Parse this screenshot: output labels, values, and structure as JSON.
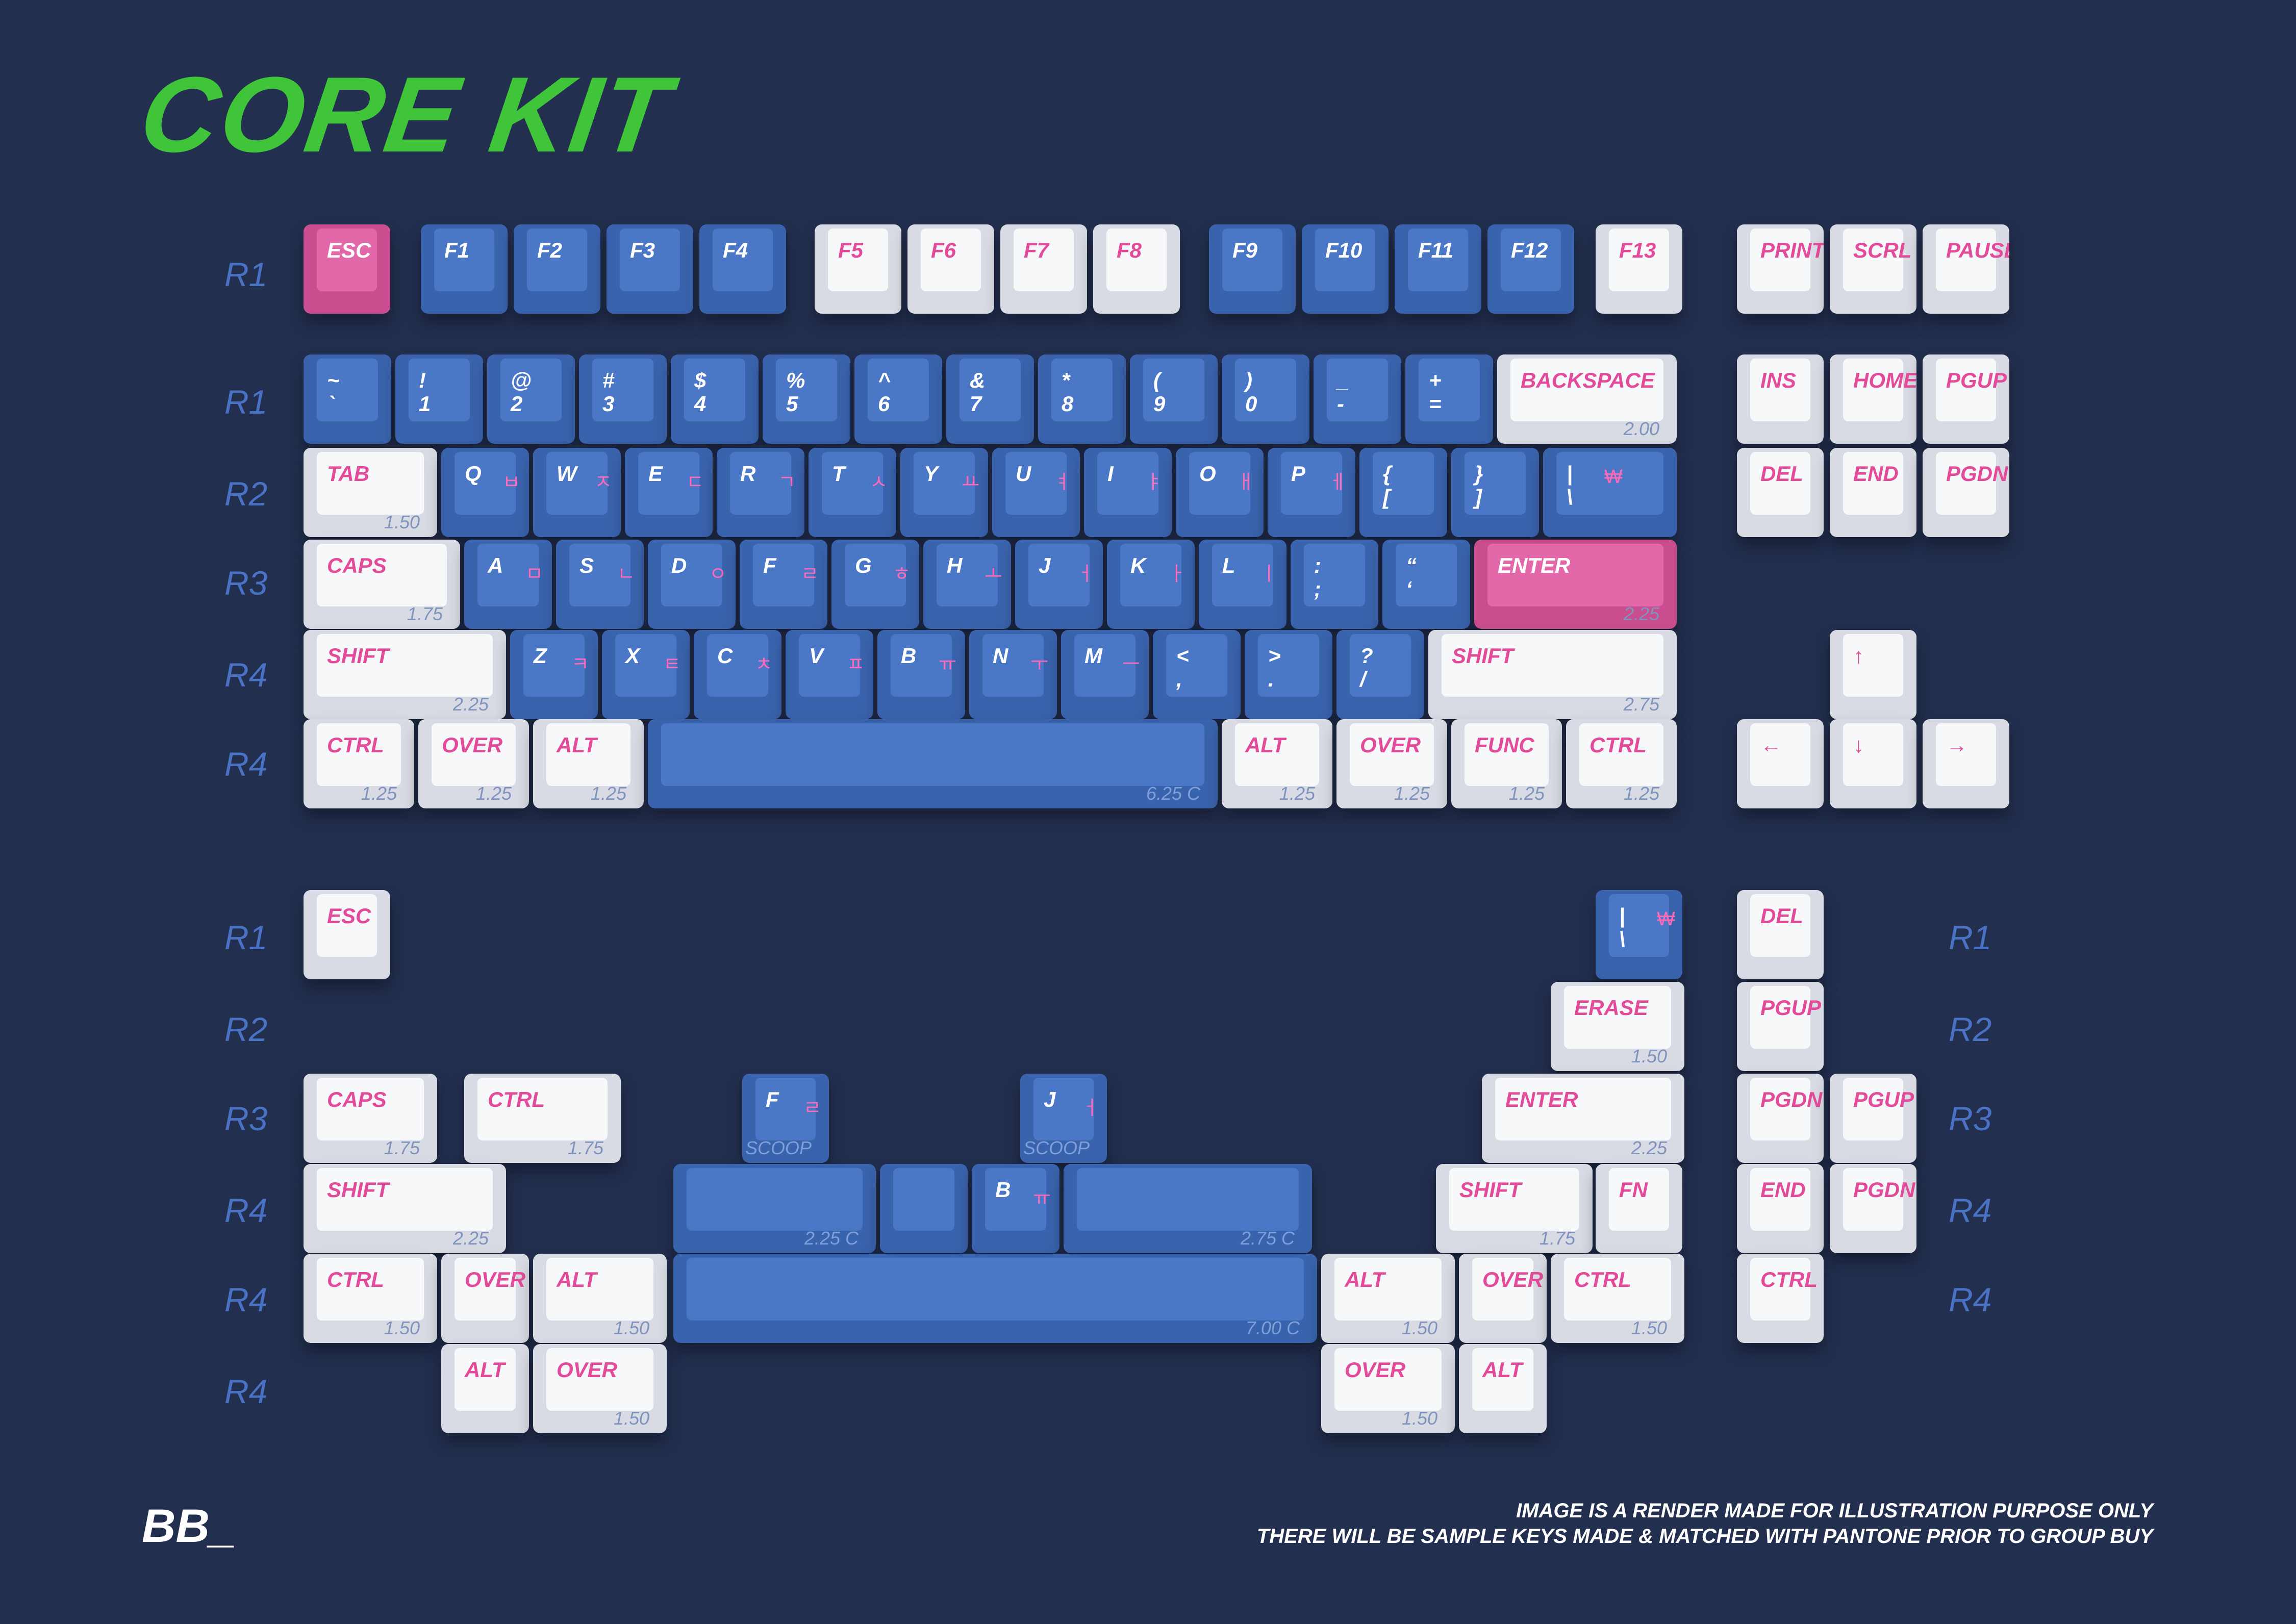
{
  "title": "CORE KIT",
  "row_labels": [
    {
      "id": "r1a",
      "text": "R1"
    },
    {
      "id": "r1b",
      "text": "R1"
    },
    {
      "id": "r2",
      "text": "R2"
    },
    {
      "id": "r3",
      "text": "R3"
    },
    {
      "id": "r4a",
      "text": "R4"
    },
    {
      "id": "r4b",
      "text": "R4"
    },
    {
      "id": "b1",
      "text": "R1"
    },
    {
      "id": "b2",
      "text": "R2"
    },
    {
      "id": "b3",
      "text": "R3"
    },
    {
      "id": "b4",
      "text": "R4"
    },
    {
      "id": "b5",
      "text": "R4"
    },
    {
      "id": "b6",
      "text": "R4"
    },
    {
      "id": "c1",
      "text": "R1"
    },
    {
      "id": "c2",
      "text": "R2"
    },
    {
      "id": "c3",
      "text": "R3"
    },
    {
      "id": "c4",
      "text": "R4"
    },
    {
      "id": "c5",
      "text": "R4"
    }
  ],
  "keys": [
    {
      "id": "esc",
      "legend": "ESC",
      "color": "pink"
    },
    {
      "id": "f1",
      "legend": "F1",
      "color": "blue"
    },
    {
      "id": "f2",
      "legend": "F2",
      "color": "blue"
    },
    {
      "id": "f3",
      "legend": "F3",
      "color": "blue"
    },
    {
      "id": "f4",
      "legend": "F4",
      "color": "blue"
    },
    {
      "id": "f5",
      "legend": "F5",
      "color": "white"
    },
    {
      "id": "f6",
      "legend": "F6",
      "color": "white"
    },
    {
      "id": "f7",
      "legend": "F7",
      "color": "white"
    },
    {
      "id": "f8",
      "legend": "F8",
      "color": "white"
    },
    {
      "id": "f9",
      "legend": "F9",
      "color": "blue"
    },
    {
      "id": "f10",
      "legend": "F10",
      "color": "blue"
    },
    {
      "id": "f11",
      "legend": "F11",
      "color": "blue"
    },
    {
      "id": "f12",
      "legend": "F12",
      "color": "blue"
    },
    {
      "id": "f13",
      "legend": "F13",
      "color": "white"
    },
    {
      "id": "print",
      "legend": "PRINT",
      "color": "white"
    },
    {
      "id": "scrl",
      "legend": "SCRL",
      "color": "white"
    },
    {
      "id": "pause",
      "legend": "PAUSE",
      "color": "white"
    },
    {
      "id": "tilde",
      "legend": "~\n`",
      "color": "blue"
    },
    {
      "id": "k1",
      "legend": "!\n1",
      "color": "blue"
    },
    {
      "id": "k2",
      "legend": "@\n2",
      "color": "blue"
    },
    {
      "id": "k3",
      "legend": "#\n3",
      "color": "blue"
    },
    {
      "id": "k4",
      "legend": "$\n4",
      "color": "blue"
    },
    {
      "id": "k5",
      "legend": "%\n5",
      "color": "blue"
    },
    {
      "id": "k6",
      "legend": "^\n6",
      "color": "blue"
    },
    {
      "id": "k7",
      "legend": "&\n7",
      "color": "blue"
    },
    {
      "id": "k8",
      "legend": "*\n8",
      "color": "blue"
    },
    {
      "id": "k9",
      "legend": "(\n9",
      "color": "blue"
    },
    {
      "id": "k0",
      "legend": ")\n0",
      "color": "blue"
    },
    {
      "id": "minus",
      "legend": "_\n-",
      "color": "blue"
    },
    {
      "id": "equal",
      "legend": "+\n=",
      "color": "blue"
    },
    {
      "id": "backspace",
      "legend": "BACKSPACE",
      "size": "2.00",
      "color": "white"
    },
    {
      "id": "ins",
      "legend": "INS",
      "color": "white"
    },
    {
      "id": "home",
      "legend": "HOME",
      "color": "white"
    },
    {
      "id": "pgup",
      "legend": "PGUP",
      "color": "white"
    },
    {
      "id": "tab",
      "legend": "TAB",
      "size": "1.50",
      "color": "white"
    },
    {
      "id": "q",
      "legend": "Q",
      "sub": "ㅂ",
      "color": "blue"
    },
    {
      "id": "w",
      "legend": "W",
      "sub": "ㅈ",
      "color": "blue"
    },
    {
      "id": "e",
      "legend": "E",
      "sub": "ㄷ",
      "color": "blue"
    },
    {
      "id": "r",
      "legend": "R",
      "sub": "ㄱ",
      "color": "blue"
    },
    {
      "id": "t",
      "legend": "T",
      "sub": "ㅅ",
      "color": "blue"
    },
    {
      "id": "y",
      "legend": "Y",
      "sub": "ㅛ",
      "color": "blue"
    },
    {
      "id": "u",
      "legend": "U",
      "sub": "ㅕ",
      "color": "blue"
    },
    {
      "id": "i",
      "legend": "I",
      "sub": "ㅑ",
      "color": "blue"
    },
    {
      "id": "o",
      "legend": "O",
      "sub": "ㅐ",
      "color": "blue"
    },
    {
      "id": "p",
      "legend": "P",
      "sub": "ㅔ",
      "color": "blue"
    },
    {
      "id": "lbracket",
      "legend": "{\n[",
      "color": "blue"
    },
    {
      "id": "rbracket",
      "legend": "}\n]",
      "color": "blue"
    },
    {
      "id": "backslash",
      "legend": "|\n\\",
      "sub": "₩",
      "color": "blue"
    },
    {
      "id": "del",
      "legend": "DEL",
      "color": "white"
    },
    {
      "id": "end",
      "legend": "END",
      "color": "white"
    },
    {
      "id": "pgdn",
      "legend": "PGDN",
      "color": "white"
    },
    {
      "id": "caps",
      "legend": "CAPS",
      "size": "1.75",
      "color": "white"
    },
    {
      "id": "a",
      "legend": "A",
      "sub": "ㅁ",
      "color": "blue"
    },
    {
      "id": "s",
      "legend": "S",
      "sub": "ㄴ",
      "color": "blue"
    },
    {
      "id": "d",
      "legend": "D",
      "sub": "ㅇ",
      "color": "blue"
    },
    {
      "id": "f",
      "legend": "F",
      "sub": "ㄹ",
      "color": "blue"
    },
    {
      "id": "g",
      "legend": "G",
      "sub": "ㅎ",
      "color": "blue"
    },
    {
      "id": "h",
      "legend": "H",
      "sub": "ㅗ",
      "color": "blue"
    },
    {
      "id": "j",
      "legend": "J",
      "sub": "ㅓ",
      "color": "blue"
    },
    {
      "id": "k",
      "legend": "K",
      "sub": "ㅏ",
      "color": "blue"
    },
    {
      "id": "l",
      "legend": "L",
      "sub": "ㅣ",
      "color": "blue"
    },
    {
      "id": "semicolon",
      "legend": ":\n;",
      "color": "blue"
    },
    {
      "id": "quote",
      "legend": "“\n‘",
      "color": "blue"
    },
    {
      "id": "enter",
      "legend": "ENTER",
      "size": "2.25",
      "color": "pink"
    },
    {
      "id": "lshift",
      "legend": "SHIFT",
      "size": "2.25",
      "color": "white"
    },
    {
      "id": "z",
      "legend": "Z",
      "sub": "ㅋ",
      "color": "blue"
    },
    {
      "id": "x",
      "legend": "X",
      "sub": "ㅌ",
      "color": "blue"
    },
    {
      "id": "c",
      "legend": "C",
      "sub": "ㅊ",
      "color": "blue"
    },
    {
      "id": "v",
      "legend": "V",
      "sub": "ㅍ",
      "color": "blue"
    },
    {
      "id": "b",
      "legend": "B",
      "sub": "ㅠ",
      "color": "blue"
    },
    {
      "id": "n",
      "legend": "N",
      "sub": "ㅜ",
      "color": "blue"
    },
    {
      "id": "m",
      "legend": "M",
      "sub": "ㅡ",
      "color": "blue"
    },
    {
      "id": "comma",
      "legend": "<\n,",
      "color": "blue"
    },
    {
      "id": "period",
      "legend": ">\n.",
      "color": "blue"
    },
    {
      "id": "slash",
      "legend": "?\n/",
      "color": "blue"
    },
    {
      "id": "rshift",
      "legend": "SHIFT",
      "size": "2.75",
      "color": "white"
    },
    {
      "id": "up",
      "legend": "↑",
      "color": "white"
    },
    {
      "id": "lctrl",
      "legend": "CTRL",
      "size": "1.25",
      "color": "white"
    },
    {
      "id": "lover",
      "legend": "OVER",
      "size": "1.25",
      "color": "white"
    },
    {
      "id": "lalt",
      "legend": "ALT",
      "size": "1.25",
      "color": "white"
    },
    {
      "id": "space",
      "legend": "",
      "size": "6.25 C",
      "color": "blue"
    },
    {
      "id": "ralt",
      "legend": "ALT",
      "size": "1.25",
      "color": "white"
    },
    {
      "id": "rover",
      "legend": "OVER",
      "size": "1.25",
      "color": "white"
    },
    {
      "id": "func",
      "legend": "FUNC",
      "size": "1.25",
      "color": "white"
    },
    {
      "id": "rctrl",
      "legend": "CTRL",
      "size": "1.25",
      "color": "white"
    },
    {
      "id": "left",
      "legend": "←",
      "color": "white"
    },
    {
      "id": "down",
      "legend": "↓",
      "color": "white"
    },
    {
      "id": "right",
      "legend": "→",
      "color": "white"
    },
    {
      "id": "x_esc",
      "legend": "ESC",
      "color": "white"
    },
    {
      "id": "x_backslash",
      "legend": "|\n\\",
      "sub": "₩",
      "color": "blue"
    },
    {
      "id": "x_del",
      "legend": "DEL",
      "color": "white"
    },
    {
      "id": "x_erase",
      "legend": "ERASE",
      "size": "1.50",
      "color": "white"
    },
    {
      "id": "x_pgup",
      "legend": "PGUP",
      "color": "white"
    },
    {
      "id": "x_caps",
      "legend": "CAPS",
      "size": "1.75",
      "color": "white"
    },
    {
      "id": "x_ctrl175",
      "legend": "CTRL",
      "size": "1.75",
      "color": "white"
    },
    {
      "id": "x_fscoop",
      "legend": "F",
      "sub": "ㄹ",
      "size": "SCOOP",
      "color": "blue"
    },
    {
      "id": "x_jscoop",
      "legend": "J",
      "sub": "ㅓ",
      "size": "SCOOP",
      "color": "blue"
    },
    {
      "id": "x_enter",
      "legend": "ENTER",
      "size": "2.25",
      "color": "white"
    },
    {
      "id": "x_pgdn",
      "legend": "PGDN",
      "color": "white"
    },
    {
      "id": "x_pgup2",
      "legend": "PGUP",
      "color": "white"
    },
    {
      "id": "x_shift225",
      "legend": "SHIFT",
      "size": "2.25",
      "color": "white"
    },
    {
      "id": "x_space225",
      "legend": "",
      "size": "2.25 C",
      "color": "blue"
    },
    {
      "id": "x_space1",
      "legend": "",
      "color": "blue"
    },
    {
      "id": "x_b",
      "legend": "B",
      "sub": "ㅠ",
      "color": "blue"
    },
    {
      "id": "x_space275",
      "legend": "",
      "size": "2.75 C",
      "color": "blue"
    },
    {
      "id": "x_shift175",
      "legend": "SHIFT",
      "size": "1.75",
      "color": "white"
    },
    {
      "id": "x_fn",
      "legend": "FN",
      "color": "white"
    },
    {
      "id": "x_end",
      "legend": "END",
      "color": "white"
    },
    {
      "id": "x_pgdn2",
      "legend": "PGDN",
      "color": "white"
    },
    {
      "id": "x_ctrl150",
      "legend": "CTRL",
      "size": "1.50",
      "color": "white"
    },
    {
      "id": "x_over1",
      "legend": "OVER",
      "color": "white"
    },
    {
      "id": "x_alt150",
      "legend": "ALT",
      "size": "1.50",
      "color": "white"
    },
    {
      "id": "x_space7",
      "legend": "",
      "size": "7.00 C",
      "color": "blue"
    },
    {
      "id": "x_ralt150",
      "legend": "ALT",
      "size": "1.50",
      "color": "white"
    },
    {
      "id": "x_rover1",
      "legend": "OVER",
      "color": "white"
    },
    {
      "id": "x_rctrl150",
      "legend": "CTRL",
      "size": "1.50",
      "color": "white"
    },
    {
      "id": "x_ctrl1",
      "legend": "CTRL",
      "color": "white"
    },
    {
      "id": "x_alt1",
      "legend": "ALT",
      "color": "white"
    },
    {
      "id": "x_over150",
      "legend": "OVER",
      "size": "1.50",
      "color": "white"
    },
    {
      "id": "x_over150r",
      "legend": "OVER",
      "size": "1.50",
      "color": "white"
    },
    {
      "id": "x_alt1r",
      "legend": "ALT",
      "color": "white"
    }
  ],
  "logo": "BB_",
  "notes": [
    "IMAGE IS A RENDER MADE FOR ILLUSTRATION PURPOSE ONLY",
    "THERE WILL BE SAMPLE KEYS MADE & MATCHED WITH PANTONE PRIOR TO GROUP BUY"
  ],
  "colors": {
    "background": "#232f4f",
    "title": "#3fc43a",
    "blue_key": "#4a77c6",
    "white_key": "#f7f8fa",
    "pink_key": "#e268a9",
    "legend_pink": "#e34b9a",
    "row_label": "#4a72c4"
  }
}
